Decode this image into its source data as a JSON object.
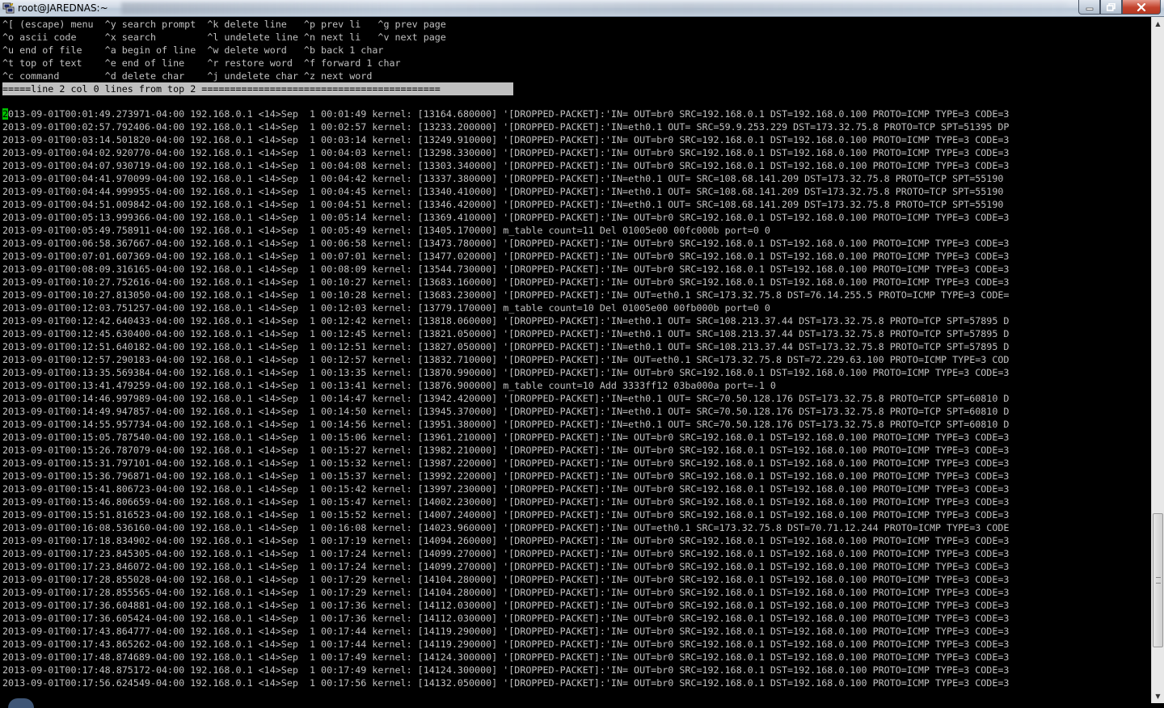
{
  "window": {
    "title": "root@JAREDNAS:~",
    "buttons": {
      "minimize": "—",
      "maximize": "□",
      "close": "✕"
    }
  },
  "colors": {
    "terminal_bg": "#000000",
    "terminal_fg": "#c0c0c0",
    "status_bg": "#c0c0c0",
    "cursor": "#00c000"
  },
  "menu_lines": [
    "^[ (escape) menu  ^y search prompt  ^k delete line   ^p prev li   ^g prev page",
    "^o ascii code     ^x search         ^l undelete line ^n next li   ^v next page",
    "^u end of file    ^a begin of line  ^w delete word   ^b back 1 char",
    "^t top of text    ^e end of line    ^r restore word  ^f forward 1 char",
    "^c command        ^d delete char    ^j undelete char ^z next word"
  ],
  "status_line": "=====line 2 col 0 lines from top 2 ==========================================",
  "cursor_char": "2",
  "log_lines": [
    "013-09-01T00:01:49.273971-04:00 192.168.0.1 <14>Sep  1 00:01:49 kernel: [13164.680000] '[DROPPED-PACKET]:'IN= OUT=br0 SRC=192.168.0.1 DST=192.168.0.100 PROTO=ICMP TYPE=3 CODE=3",
    "2013-09-01T00:02:57.792406-04:00 192.168.0.1 <14>Sep  1 00:02:57 kernel: [13233.200000] '[DROPPED-PACKET]:'IN=eth0.1 OUT= SRC=59.9.253.229 DST=173.32.75.8 PROTO=TCP SPT=51395 DP",
    "2013-09-01T00:03:14.501820-04:00 192.168.0.1 <14>Sep  1 00:03:14 kernel: [13249.910000] '[DROPPED-PACKET]:'IN= OUT=br0 SRC=192.168.0.1 DST=192.168.0.100 PROTO=ICMP TYPE=3 CODE=3",
    "2013-09-01T00:04:02.920770-04:00 192.168.0.1 <14>Sep  1 00:04:03 kernel: [13298.330000] '[DROPPED-PACKET]:'IN= OUT=br0 SRC=192.168.0.1 DST=192.168.0.100 PROTO=ICMP TYPE=3 CODE=3",
    "2013-09-01T00:04:07.930719-04:00 192.168.0.1 <14>Sep  1 00:04:08 kernel: [13303.340000] '[DROPPED-PACKET]:'IN= OUT=br0 SRC=192.168.0.1 DST=192.168.0.100 PROTO=ICMP TYPE=3 CODE=3",
    "2013-09-01T00:04:41.970099-04:00 192.168.0.1 <14>Sep  1 00:04:42 kernel: [13337.380000] '[DROPPED-PACKET]:'IN=eth0.1 OUT= SRC=108.68.141.209 DST=173.32.75.8 PROTO=TCP SPT=55190",
    "2013-09-01T00:04:44.999955-04:00 192.168.0.1 <14>Sep  1 00:04:45 kernel: [13340.410000] '[DROPPED-PACKET]:'IN=eth0.1 OUT= SRC=108.68.141.209 DST=173.32.75.8 PROTO=TCP SPT=55190",
    "2013-09-01T00:04:51.009842-04:00 192.168.0.1 <14>Sep  1 00:04:51 kernel: [13346.420000] '[DROPPED-PACKET]:'IN=eth0.1 OUT= SRC=108.68.141.209 DST=173.32.75.8 PROTO=TCP SPT=55190",
    "2013-09-01T00:05:13.999366-04:00 192.168.0.1 <14>Sep  1 00:05:14 kernel: [13369.410000] '[DROPPED-PACKET]:'IN= OUT=br0 SRC=192.168.0.1 DST=192.168.0.100 PROTO=ICMP TYPE=3 CODE=3",
    "2013-09-01T00:05:49.758911-04:00 192.168.0.1 <14>Sep  1 00:05:49 kernel: [13405.170000] m_table count=11 Del 01005e00 00fc000b port=0 0",
    "2013-09-01T00:06:58.367667-04:00 192.168.0.1 <14>Sep  1 00:06:58 kernel: [13473.780000] '[DROPPED-PACKET]:'IN= OUT=br0 SRC=192.168.0.1 DST=192.168.0.100 PROTO=ICMP TYPE=3 CODE=3",
    "2013-09-01T00:07:01.607369-04:00 192.168.0.1 <14>Sep  1 00:07:01 kernel: [13477.020000] '[DROPPED-PACKET]:'IN= OUT=br0 SRC=192.168.0.1 DST=192.168.0.100 PROTO=ICMP TYPE=3 CODE=3",
    "2013-09-01T00:08:09.316165-04:00 192.168.0.1 <14>Sep  1 00:08:09 kernel: [13544.730000] '[DROPPED-PACKET]:'IN= OUT=br0 SRC=192.168.0.1 DST=192.168.0.100 PROTO=ICMP TYPE=3 CODE=3",
    "2013-09-01T00:10:27.752616-04:00 192.168.0.1 <14>Sep  1 00:10:27 kernel: [13683.160000] '[DROPPED-PACKET]:'IN= OUT=br0 SRC=192.168.0.1 DST=192.168.0.100 PROTO=ICMP TYPE=3 CODE=3",
    "2013-09-01T00:10:27.813050-04:00 192.168.0.1 <14>Sep  1 00:10:28 kernel: [13683.230000] '[DROPPED-PACKET]:'IN= OUT=eth0.1 SRC=173.32.75.8 DST=76.14.255.5 PROTO=ICMP TYPE=3 CODE=",
    "2013-09-01T00:12:03.751257-04:00 192.168.0.1 <14>Sep  1 00:12:03 kernel: [13779.170000] m_table count=10 Del 01005e00 00fb000b port=0 0",
    "2013-09-01T00:12:42.640433-04:00 192.168.0.1 <14>Sep  1 00:12:42 kernel: [13818.060000] '[DROPPED-PACKET]:'IN=eth0.1 OUT= SRC=108.213.37.44 DST=173.32.75.8 PROTO=TCP SPT=57895 D",
    "2013-09-01T00:12:45.630400-04:00 192.168.0.1 <14>Sep  1 00:12:45 kernel: [13821.050000] '[DROPPED-PACKET]:'IN=eth0.1 OUT= SRC=108.213.37.44 DST=173.32.75.8 PROTO=TCP SPT=57895 D",
    "2013-09-01T00:12:51.640182-04:00 192.168.0.1 <14>Sep  1 00:12:51 kernel: [13827.050000] '[DROPPED-PACKET]:'IN=eth0.1 OUT= SRC=108.213.37.44 DST=173.32.75.8 PROTO=TCP SPT=57895 D",
    "2013-09-01T00:12:57.290183-04:00 192.168.0.1 <14>Sep  1 00:12:57 kernel: [13832.710000] '[DROPPED-PACKET]:'IN= OUT=eth0.1 SRC=173.32.75.8 DST=72.229.63.100 PROTO=ICMP TYPE=3 COD",
    "2013-09-01T00:13:35.569384-04:00 192.168.0.1 <14>Sep  1 00:13:35 kernel: [13870.990000] '[DROPPED-PACKET]:'IN= OUT=br0 SRC=192.168.0.1 DST=192.168.0.100 PROTO=ICMP TYPE=3 CODE=3",
    "2013-09-01T00:13:41.479259-04:00 192.168.0.1 <14>Sep  1 00:13:41 kernel: [13876.900000] m_table count=10 Add 3333ff12 03ba000a port=-1 0",
    "2013-09-01T00:14:46.997989-04:00 192.168.0.1 <14>Sep  1 00:14:47 kernel: [13942.420000] '[DROPPED-PACKET]:'IN=eth0.1 OUT= SRC=70.50.128.176 DST=173.32.75.8 PROTO=TCP SPT=60810 D",
    "2013-09-01T00:14:49.947857-04:00 192.168.0.1 <14>Sep  1 00:14:50 kernel: [13945.370000] '[DROPPED-PACKET]:'IN=eth0.1 OUT= SRC=70.50.128.176 DST=173.32.75.8 PROTO=TCP SPT=60810 D",
    "2013-09-01T00:14:55.957734-04:00 192.168.0.1 <14>Sep  1 00:14:56 kernel: [13951.380000] '[DROPPED-PACKET]:'IN=eth0.1 OUT= SRC=70.50.128.176 DST=173.32.75.8 PROTO=TCP SPT=60810 D",
    "2013-09-01T00:15:05.787540-04:00 192.168.0.1 <14>Sep  1 00:15:06 kernel: [13961.210000] '[DROPPED-PACKET]:'IN= OUT=br0 SRC=192.168.0.1 DST=192.168.0.100 PROTO=ICMP TYPE=3 CODE=3",
    "2013-09-01T00:15:26.787079-04:00 192.168.0.1 <14>Sep  1 00:15:27 kernel: [13982.210000] '[DROPPED-PACKET]:'IN= OUT=br0 SRC=192.168.0.1 DST=192.168.0.100 PROTO=ICMP TYPE=3 CODE=3",
    "2013-09-01T00:15:31.797101-04:00 192.168.0.1 <14>Sep  1 00:15:32 kernel: [13987.220000] '[DROPPED-PACKET]:'IN= OUT=br0 SRC=192.168.0.1 DST=192.168.0.100 PROTO=ICMP TYPE=3 CODE=3",
    "2013-09-01T00:15:36.796871-04:00 192.168.0.1 <14>Sep  1 00:15:37 kernel: [13992.220000] '[DROPPED-PACKET]:'IN= OUT=br0 SRC=192.168.0.1 DST=192.168.0.100 PROTO=ICMP TYPE=3 CODE=3",
    "2013-09-01T00:15:41.806723-04:00 192.168.0.1 <14>Sep  1 00:15:42 kernel: [13997.230000] '[DROPPED-PACKET]:'IN= OUT=br0 SRC=192.168.0.1 DST=192.168.0.100 PROTO=ICMP TYPE=3 CODE=3",
    "2013-09-01T00:15:46.806659-04:00 192.168.0.1 <14>Sep  1 00:15:47 kernel: [14002.230000] '[DROPPED-PACKET]:'IN= OUT=br0 SRC=192.168.0.1 DST=192.168.0.100 PROTO=ICMP TYPE=3 CODE=3",
    "2013-09-01T00:15:51.816523-04:00 192.168.0.1 <14>Sep  1 00:15:52 kernel: [14007.240000] '[DROPPED-PACKET]:'IN= OUT=br0 SRC=192.168.0.1 DST=192.168.0.100 PROTO=ICMP TYPE=3 CODE=3",
    "2013-09-01T00:16:08.536160-04:00 192.168.0.1 <14>Sep  1 00:16:08 kernel: [14023.960000] '[DROPPED-PACKET]:'IN= OUT=eth0.1 SRC=173.32.75.8 DST=70.71.12.244 PROTO=ICMP TYPE=3 CODE",
    "2013-09-01T00:17:18.834902-04:00 192.168.0.1 <14>Sep  1 00:17:19 kernel: [14094.260000] '[DROPPED-PACKET]:'IN= OUT=br0 SRC=192.168.0.1 DST=192.168.0.100 PROTO=ICMP TYPE=3 CODE=3",
    "2013-09-01T00:17:23.845305-04:00 192.168.0.1 <14>Sep  1 00:17:24 kernel: [14099.270000] '[DROPPED-PACKET]:'IN= OUT=br0 SRC=192.168.0.1 DST=192.168.0.100 PROTO=ICMP TYPE=3 CODE=3",
    "2013-09-01T00:17:23.846072-04:00 192.168.0.1 <14>Sep  1 00:17:24 kernel: [14099.270000] '[DROPPED-PACKET]:'IN= OUT=br0 SRC=192.168.0.1 DST=192.168.0.100 PROTO=ICMP TYPE=3 CODE=3",
    "2013-09-01T00:17:28.855028-04:00 192.168.0.1 <14>Sep  1 00:17:29 kernel: [14104.280000] '[DROPPED-PACKET]:'IN= OUT=br0 SRC=192.168.0.1 DST=192.168.0.100 PROTO=ICMP TYPE=3 CODE=3",
    "2013-09-01T00:17:28.855565-04:00 192.168.0.1 <14>Sep  1 00:17:29 kernel: [14104.280000] '[DROPPED-PACKET]:'IN= OUT=br0 SRC=192.168.0.1 DST=192.168.0.100 PROTO=ICMP TYPE=3 CODE=3",
    "2013-09-01T00:17:36.604881-04:00 192.168.0.1 <14>Sep  1 00:17:36 kernel: [14112.030000] '[DROPPED-PACKET]:'IN= OUT=br0 SRC=192.168.0.1 DST=192.168.0.100 PROTO=ICMP TYPE=3 CODE=3",
    "2013-09-01T00:17:36.605424-04:00 192.168.0.1 <14>Sep  1 00:17:36 kernel: [14112.030000] '[DROPPED-PACKET]:'IN= OUT=br0 SRC=192.168.0.1 DST=192.168.0.100 PROTO=ICMP TYPE=3 CODE=3",
    "2013-09-01T00:17:43.864777-04:00 192.168.0.1 <14>Sep  1 00:17:44 kernel: [14119.290000] '[DROPPED-PACKET]:'IN= OUT=br0 SRC=192.168.0.1 DST=192.168.0.100 PROTO=ICMP TYPE=3 CODE=3",
    "2013-09-01T00:17:43.865262-04:00 192.168.0.1 <14>Sep  1 00:17:44 kernel: [14119.290000] '[DROPPED-PACKET]:'IN= OUT=br0 SRC=192.168.0.1 DST=192.168.0.100 PROTO=ICMP TYPE=3 CODE=3",
    "2013-09-01T00:17:48.874689-04:00 192.168.0.1 <14>Sep  1 00:17:49 kernel: [14124.300000] '[DROPPED-PACKET]:'IN= OUT=br0 SRC=192.168.0.1 DST=192.168.0.100 PROTO=ICMP TYPE=3 CODE=3",
    "2013-09-01T00:17:48.875172-04:00 192.168.0.1 <14>Sep  1 00:17:49 kernel: [14124.300000] '[DROPPED-PACKET]:'IN= OUT=br0 SRC=192.168.0.1 DST=192.168.0.100 PROTO=ICMP TYPE=3 CODE=3",
    "2013-09-01T00:17:56.624549-04:00 192.168.0.1 <14>Sep  1 00:17:56 kernel: [14132.050000] '[DROPPED-PACKET]:'IN= OUT=br0 SRC=192.168.0.1 DST=192.168.0.100 PROTO=ICMP TYPE=3 CODE=3"
  ],
  "scrollbar": {
    "up_icon": "▲",
    "down_icon": "▼",
    "position_fraction": 0.92
  }
}
